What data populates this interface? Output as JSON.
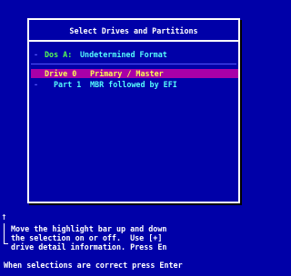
{
  "dialog": {
    "title": "Select Drives and Partitions",
    "rows": [
      {
        "col1": "Dos A:",
        "col2": "Undetermined Format",
        "col1_color": "#54fc54",
        "col2_color": "#54fcfc"
      },
      {
        "col1": "Drive 0",
        "col2": "Primary / Master",
        "selected": true,
        "highlight_color": "#a800a8",
        "text_color": "#fcfc54"
      },
      {
        "col1": "Part 1",
        "col2": "MBR followed by EFI",
        "text_color": "#54fcfc"
      }
    ]
  },
  "help": {
    "icon": "up-arrow-icon",
    "lines": [
      "Move the highlight bar up and down",
      "the selection on or off.  Use [+]",
      "drive detail information. Press En"
    ]
  },
  "status": {
    "text": "When selections are correct press Enter"
  },
  "colors": {
    "background": "#0000a8",
    "border": "#ffffff",
    "highlight": "#a800a8"
  }
}
